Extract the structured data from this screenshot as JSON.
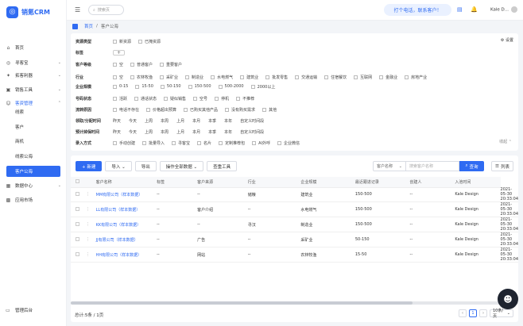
{
  "app": {
    "name": "销氪CRM"
  },
  "header": {
    "search_placeholder": "搜索页",
    "call_button": "打个电话，联系客户！",
    "user_name": "Kale D..."
  },
  "sidebar": {
    "items": [
      {
        "label": "首页",
        "icon": "home-icon",
        "chev": ""
      },
      {
        "label": "寻客宝",
        "icon": "target-icon",
        "chev": "⌄"
      },
      {
        "label": "拓客利器",
        "icon": "tool-icon",
        "chev": "⌄"
      },
      {
        "label": "销售工具",
        "icon": "briefcase-icon",
        "chev": "⌄"
      },
      {
        "label": "客资管理",
        "icon": "user-icon",
        "chev": "⌃"
      }
    ],
    "sub_items": [
      "线索",
      "客户",
      "商机",
      "线索公海",
      "客户公海"
    ],
    "more_items": [
      {
        "label": "数据中心",
        "icon": "chart-icon",
        "chev": "⌄"
      },
      {
        "label": "应用市场",
        "icon": "grid-icon",
        "chev": ""
      }
    ],
    "bottom": "管理后台"
  },
  "breadcrumb": {
    "home": "首页",
    "sep": "/",
    "current": "客户公海"
  },
  "filters": {
    "settings": "设置",
    "collapse": "收起 ⌃",
    "rows": [
      {
        "label": "资源类型",
        "options": [
          "新资源",
          "已掩资源"
        ],
        "checkbox": true
      },
      {
        "label": "标签",
        "options": [],
        "checkbox": false,
        "plus": "+"
      },
      {
        "label": "客户等级",
        "options": [
          "空",
          "普通客户",
          "重要客户"
        ],
        "checkbox": true
      },
      {
        "label": "行业",
        "options": [
          "空",
          "农林牧渔",
          "采矿业",
          "制造业",
          "水电燃气",
          "建筑业",
          "批发零售",
          "交通运输",
          "住宿餐饮",
          "互联网",
          "金融业",
          "房地产业"
        ],
        "checkbox": true
      },
      {
        "label": "企业规模",
        "options": [
          "0-15",
          "15-50",
          "50-150",
          "150-500",
          "500-2000",
          "2000以上"
        ],
        "checkbox": true
      },
      {
        "label": "号码状态",
        "options": [
          "活跃",
          "通话状态",
          "疑似销售",
          "空号",
          "停机",
          "不推荐"
        ],
        "checkbox": true
      },
      {
        "label": "流转原因",
        "options": [
          "电话不存在",
          "价格超出预算",
          "已购买其他产品",
          "没有购买需求",
          "其他"
        ],
        "checkbox": true
      },
      {
        "label": "领取/分配时间",
        "options": [
          "昨天",
          "今天",
          "上周",
          "本周",
          "上月",
          "本月",
          "本季",
          "本年",
          "自定义时间段"
        ],
        "checkbox": false
      },
      {
        "label": "预计掉保时间",
        "options": [
          "昨天",
          "今天",
          "上周",
          "本周",
          "上月",
          "本月",
          "本季",
          "本年",
          "自定义时间段"
        ],
        "checkbox": false
      },
      {
        "label": "录入方式",
        "options": [
          "手动创建",
          "批量导入",
          "寻客宝",
          "名片",
          "定制推荐包",
          "AI外呼",
          "企业微信"
        ],
        "checkbox": true
      }
    ]
  },
  "toolbar": {
    "new": "+ 新建",
    "import": "导入 ⌄",
    "export": "导出",
    "bulk": "操作全部数据 ⌄",
    "dedupe": "查重工具",
    "search_field": "客户名称",
    "search_placeholder": "搜索客户名称",
    "search_button": "查询",
    "columns": "列表"
  },
  "table": {
    "headers": [
      "客户名称",
      "标签",
      "客户来源",
      "行业",
      "企业规模",
      "最近跟进记录",
      "创建人",
      "入池时间"
    ],
    "rows": [
      [
        "MM有限公司（样本数据）",
        "--",
        "--",
        "储粮",
        "建筑业",
        "150-500",
        "--",
        "Kale Design",
        "2021-05-30 20:33:04"
      ],
      [
        "LL有限公司（样本数据）",
        "--",
        "客户介绍",
        "--",
        "水电燃气",
        "150-500",
        "--",
        "Kale Design",
        "2021-05-30 20:33:04"
      ],
      [
        "KK有限公司（样本数据）",
        "--",
        "--",
        "寻汉",
        "制造业",
        "150-500",
        "--",
        "Kale Design",
        "2021-05-30 20:33:04"
      ],
      [
        "JJ有限公司（样本数据）",
        "--",
        "广告",
        "--",
        "采矿业",
        "50-150",
        "--",
        "Kale Design",
        "2021-05-30 20:33:04"
      ],
      [
        "HH有限公司（样本数据）",
        "--",
        "网站",
        "--",
        "农林牧渔",
        "15-50",
        "--",
        "Kale Design",
        "2021-05-30 20:33:04"
      ]
    ]
  },
  "footer": {
    "total": "总计:5条 / 1页",
    "prev": "‹",
    "page": "1",
    "next": "›",
    "page_size": "10条/页"
  }
}
